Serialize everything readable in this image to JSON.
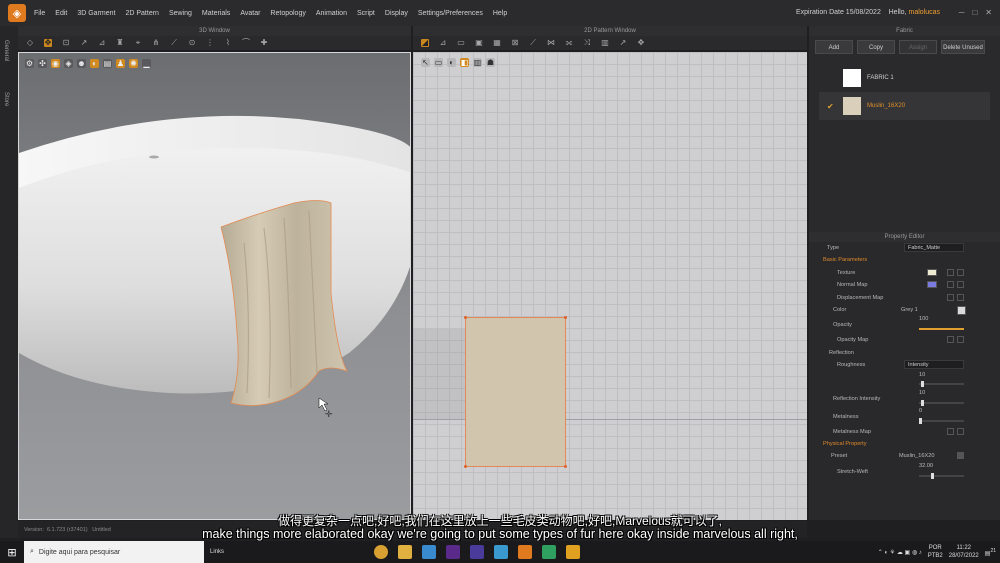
{
  "menubar": {
    "items": [
      "File",
      "Edit",
      "3D Garment",
      "2D Pattern",
      "Sewing",
      "Materials",
      "Avatar",
      "Retopology",
      "Animation",
      "Script",
      "Display",
      "Settings/Preferences",
      "Help"
    ],
    "expiration": "Expiration Date 15/08/2022",
    "hello": "Hello,",
    "user": "malolucas"
  },
  "sidestrip": {
    "tabs": [
      "General",
      "Store"
    ]
  },
  "window3d": {
    "title": "3D Window"
  },
  "window2d": {
    "title": "2D Pattern Window"
  },
  "fabric": {
    "title": "Fabric",
    "buttons": {
      "add": "Add",
      "copy": "Copy",
      "assign": "Assign",
      "delete_unused": "Delete Unused"
    },
    "items": [
      {
        "name": "FABRIC 1",
        "color": "#ffffff"
      },
      {
        "name": "Muslin_16X20",
        "color": "#d9cfbb"
      }
    ]
  },
  "property_editor": {
    "title": "Property Editor",
    "type_label": "Type",
    "type_value": "Fabric_Matte",
    "basic_parameters": "Basic Parameters",
    "texture": "Texture",
    "normal_map": "Normal Map",
    "displacement_map": "Displacement Map",
    "color_label": "Color",
    "color_value": "Grey 1",
    "opacity": "Opacity",
    "opacity_value": "100",
    "opacity_map": "Opacity Map",
    "reflection": "Reflection",
    "roughness": "Roughness",
    "roughness_value": "Intensity",
    "roughness_num": "10",
    "reflection_intensity": "Reflection Intensity",
    "reflection_intensity_num": "10",
    "metalness": "Metalness",
    "metalness_num": "0",
    "metalness_map": "Metalness Map",
    "physical_property": "Physical Property",
    "preset": "Preset",
    "preset_value": "Muslin_16X20",
    "stretch_weft": "Stretch-Weft",
    "stretch_weft_num": "32.00",
    "colors": {
      "texture_swatch": "#ecebd2",
      "normal_swatch": "#7a7ae0",
      "color_swatch": "#dadada"
    }
  },
  "statusbar": {
    "version_label": "Version:",
    "version": "6.1.723 (r37401)",
    "file": "Untitled"
  },
  "subtitles": {
    "chinese": "做得更复杂一点吧,好吧,我们在这里放上一些毛皮类动物吧,好吧,Marvelous就可以了,",
    "english": "make things more elaborated okay we're going to put some types of fur here okay inside marvelous all right,"
  },
  "taskbar": {
    "search_placeholder": "Digite aqui para pesquisar",
    "links": "Links",
    "lang": "POR",
    "lang2": "PTB2",
    "time": "11:22",
    "date": "28/07/2022",
    "notif": "21"
  }
}
